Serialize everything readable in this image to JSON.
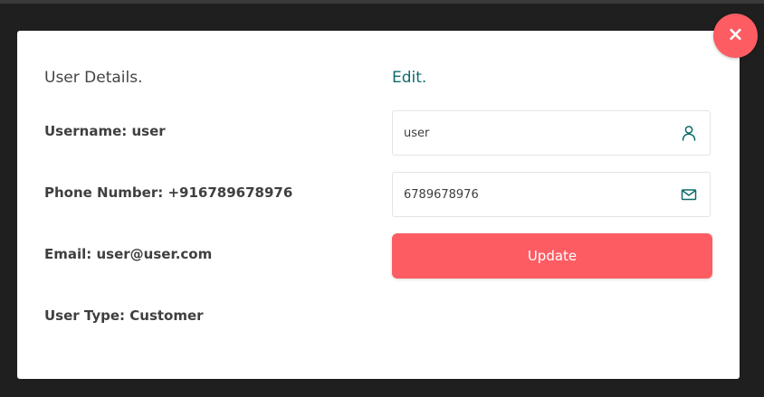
{
  "close_button": {
    "label": "×"
  },
  "details": {
    "title": "User Details.",
    "username_line": "Username: user",
    "phone_line": "Phone Number: +916789678976",
    "email_line": "Email: user@user.com",
    "user_type_line": "User Type: Customer"
  },
  "edit": {
    "title": "Edit.",
    "username_value": "user",
    "username_icon": "user-icon",
    "phone_value": "6789678976",
    "phone_icon": "envelope-icon",
    "update_label": "Update"
  },
  "colors": {
    "accent": "#fd5c63",
    "teal": "#0e6b6b",
    "backdrop": "#1f1f1f"
  }
}
